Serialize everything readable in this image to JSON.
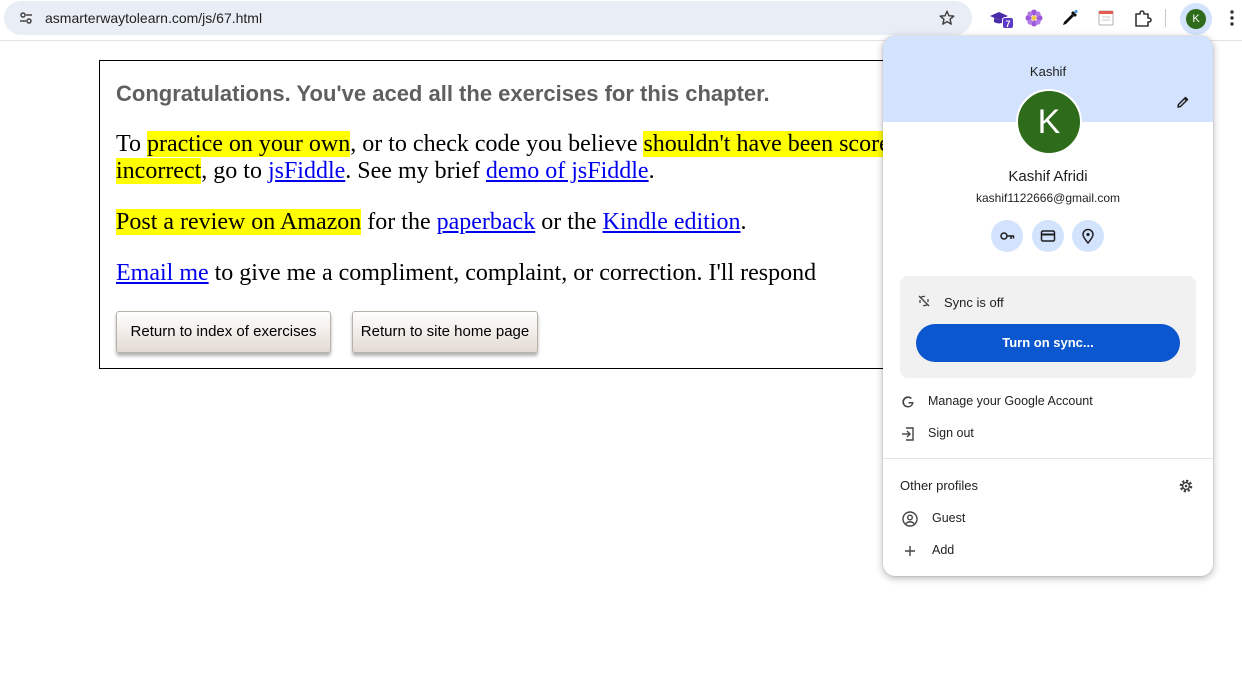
{
  "browser": {
    "url": "asmarterwaytolearn.com/js/67.html",
    "extension_badge": "7",
    "avatar_letter": "K",
    "icons": [
      "site-info-icon",
      "star-icon",
      "graduation-cap-extension-icon",
      "flower-extension-icon",
      "eyedropper-extension-icon",
      "notes-extension-icon",
      "puzzle-extensions-icon",
      "avatar",
      "more-vert-icon"
    ]
  },
  "page": {
    "congrats": "Congratulations. You've aced all the exercises for this chapter.",
    "p1": {
      "t1": "To ",
      "hl1": "practice on your own",
      "t2": ", or to check code you believe ",
      "hl2": "shouldn't have been scored as incorrect",
      "t3": ", go to ",
      "link1": "jsFiddle",
      "t4": ". See my brief ",
      "link2": "demo of jsFiddle",
      "t5": "."
    },
    "p2": {
      "hl1": "Post a review on Amazon",
      "t1": " for the ",
      "link1": "paperback",
      "t2": " or the ",
      "link2": "Kindle edition",
      "t3": "."
    },
    "p3": {
      "link1": "Email me",
      "t1": " to give me a compliment, complaint, or correction. I'll respond"
    },
    "buttons": {
      "index": "Return to index of exercises",
      "home": "Return to site home page"
    },
    "colors": {
      "highlight": "#ffff00",
      "link": "#0000ee"
    }
  },
  "profile_menu": {
    "header_name": "Kashif",
    "avatar_letter": "K",
    "full_name": "Kashif Afridi",
    "email": "kashif1122666@gmail.com",
    "quick_icons": [
      "key-icon",
      "credit-card-icon",
      "location-pin-icon"
    ],
    "sync_status": "Sync is off",
    "sync_button": "Turn on sync...",
    "manage_account": "Manage your Google Account",
    "sign_out": "Sign out",
    "other_profiles": "Other profiles",
    "guest": "Guest",
    "add": "Add",
    "colors": {
      "header": "#d3e3fd",
      "avatar": "#2e6b1b",
      "sync_button": "#0b57d0"
    }
  }
}
